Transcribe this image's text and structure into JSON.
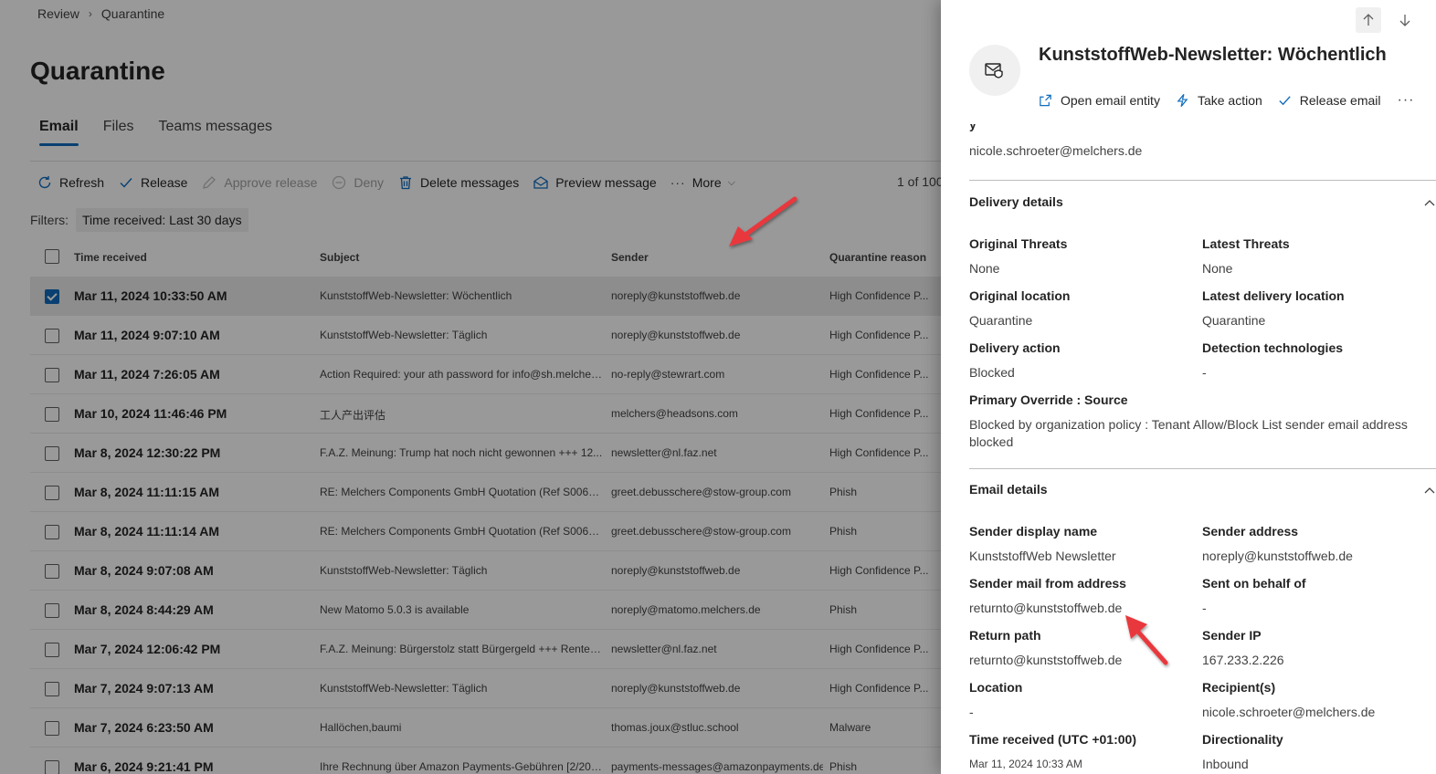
{
  "breadcrumb": {
    "items": [
      "Review",
      "Quarantine"
    ]
  },
  "page": {
    "title": "Quarantine"
  },
  "tabs": [
    {
      "label": "Email",
      "active": true
    },
    {
      "label": "Files",
      "active": false
    },
    {
      "label": "Teams messages",
      "active": false
    }
  ],
  "toolbar": {
    "refresh": "Refresh",
    "release": "Release",
    "approve_release": "Approve release",
    "deny": "Deny",
    "delete": "Delete messages",
    "preview": "Preview message",
    "more": "More",
    "pager": "1 of 100"
  },
  "filters": {
    "label": "Filters:",
    "chip": "Time received: Last 30 days"
  },
  "grid": {
    "headers": {
      "time": "Time received",
      "subject": "Subject",
      "sender": "Sender",
      "reason": "Quarantine reason"
    },
    "rows": [
      {
        "time": "Mar 11, 2024 10:33:50 AM",
        "subject": "KunststoffWeb-Newsletter: Wöchentlich",
        "sender": "noreply@kunststoffweb.de",
        "reason": "High Confidence P...",
        "selected": true
      },
      {
        "time": "Mar 11, 2024 9:07:10 AM",
        "subject": "KunststoffWeb-Newsletter: Täglich",
        "sender": "noreply@kunststoffweb.de",
        "reason": "High Confidence P...",
        "selected": false
      },
      {
        "time": "Mar 11, 2024 7:26:05 AM",
        "subject": "Action Required: your ath password for info@sh.melcher...",
        "sender": "no-reply@stewrart.com",
        "reason": "High Confidence P...",
        "selected": false
      },
      {
        "time": "Mar 10, 2024 11:46:46 PM",
        "subject": "工人产出评估",
        "sender": "melchers@headsons.com",
        "reason": "High Confidence P...",
        "selected": false
      },
      {
        "time": "Mar 8, 2024 12:30:22 PM",
        "subject": "F.A.Z. Meinung: Trump hat noch nicht gewonnen +++ 12...",
        "sender": "newsletter@nl.faz.net",
        "reason": "High Confidence P...",
        "selected": false
      },
      {
        "time": "Mar 8, 2024 11:11:15 AM",
        "subject": "RE: Melchers Components GmbH Quotation (Ref S00629[...",
        "sender": "greet.debusschere@stow-group.com",
        "reason": "Phish",
        "selected": false
      },
      {
        "time": "Mar 8, 2024 11:11:14 AM",
        "subject": "RE: Melchers Components GmbH Quotation (Ref S00629[...",
        "sender": "greet.debusschere@stow-group.com",
        "reason": "Phish",
        "selected": false
      },
      {
        "time": "Mar 8, 2024 9:07:08 AM",
        "subject": "KunststoffWeb-Newsletter: Täglich",
        "sender": "noreply@kunststoffweb.de",
        "reason": "High Confidence P...",
        "selected": false
      },
      {
        "time": "Mar 8, 2024 8:44:29 AM",
        "subject": "New Matomo 5.0.3 is available",
        "sender": "noreply@matomo.melchers.de",
        "reason": "Phish",
        "selected": false
      },
      {
        "time": "Mar 7, 2024 12:06:42 PM",
        "subject": "F.A.Z. Meinung: Bürgerstolz statt Bürgergeld +++ Renten...",
        "sender": "newsletter@nl.faz.net",
        "reason": "High Confidence P...",
        "selected": false
      },
      {
        "time": "Mar 7, 2024 9:07:13 AM",
        "subject": "KunststoffWeb-Newsletter: Täglich",
        "sender": "noreply@kunststoffweb.de",
        "reason": "High Confidence P...",
        "selected": false
      },
      {
        "time": "Mar 7, 2024 6:23:50 AM",
        "subject": "Hallöchen,baumi",
        "sender": "thomas.joux@stluc.school",
        "reason": "Malware",
        "selected": false
      },
      {
        "time": "Mar 6, 2024 9:21:41 PM",
        "subject": "Ihre Rechnung über Amazon Payments-Gebühren [2/2024]",
        "sender": "payments-messages@amazonpayments.de",
        "reason": "Phish",
        "selected": false
      }
    ]
  },
  "panel": {
    "title": "KunststoffWeb-Newsletter: Wöchentlich",
    "actions": {
      "open_entity": "Open email entity",
      "take_action": "Take action",
      "release_email": "Release email",
      "more": "···"
    },
    "recipient_top": "nicole.schroeter@melchers.de",
    "delivery": {
      "heading": "Delivery details",
      "original_threats_label": "Original Threats",
      "original_threats": "None",
      "latest_threats_label": "Latest Threats",
      "latest_threats": "None",
      "original_location_label": "Original location",
      "original_location": "Quarantine",
      "latest_location_label": "Latest delivery location",
      "latest_location": "Quarantine",
      "delivery_action_label": "Delivery action",
      "delivery_action": "Blocked",
      "detection_label": "Detection technologies",
      "detection": "-",
      "override_label": "Primary Override : Source",
      "override": "Blocked by organization policy : Tenant Allow/Block List sender email address blocked"
    },
    "email": {
      "heading": "Email details",
      "display_name_label": "Sender display name",
      "display_name": "KunststoffWeb Newsletter",
      "sender_address_label": "Sender address",
      "sender_address": "noreply@kunststoffweb.de",
      "mail_from_label": "Sender mail from address",
      "mail_from": "returnto@kunststoffweb.de",
      "behalf_label": "Sent on behalf of",
      "behalf": "-",
      "return_path_label": "Return path",
      "return_path": "returnto@kunststoffweb.de",
      "sender_ip_label": "Sender IP",
      "sender_ip": "167.233.2.226",
      "location_label": "Location",
      "location": "-",
      "recipients_label": "Recipient(s)",
      "recipients": "nicole.schroeter@melchers.de",
      "time_received_label": "Time received (UTC +01:00)",
      "time_received": "Mar 11, 2024 10:33 AM",
      "directionality_label": "Directionality",
      "directionality": "Inbound"
    }
  },
  "colors": {
    "accent": "#0f6cbd",
    "annotation_arrow": "#e8383d"
  }
}
